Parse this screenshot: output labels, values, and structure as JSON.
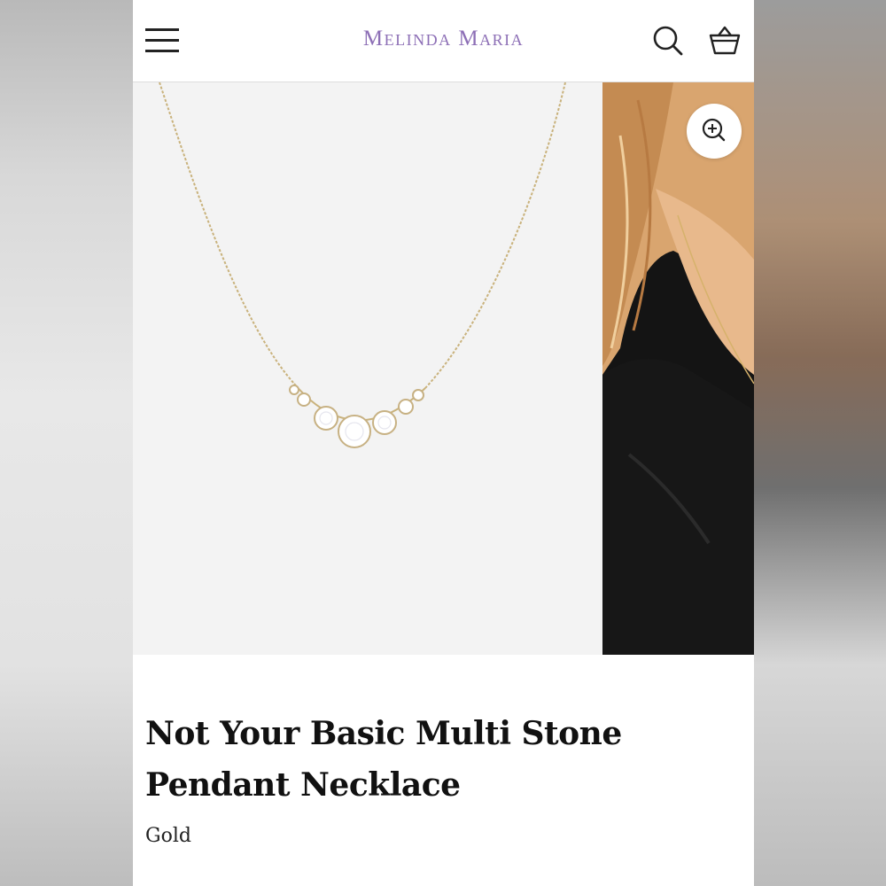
{
  "header": {
    "brand": "Melinda Maria",
    "menu_icon": "hamburger-menu-icon",
    "search_icon": "search-icon",
    "bag_icon": "shopping-basket-icon"
  },
  "gallery": {
    "zoom_icon": "zoom-in-icon"
  },
  "product": {
    "title": "Not Your Basic Multi Stone Pendant Necklace",
    "variant": "Gold"
  },
  "colors": {
    "brand": "#8d6fb6",
    "text": "#111111",
    "background": "#ffffff"
  }
}
